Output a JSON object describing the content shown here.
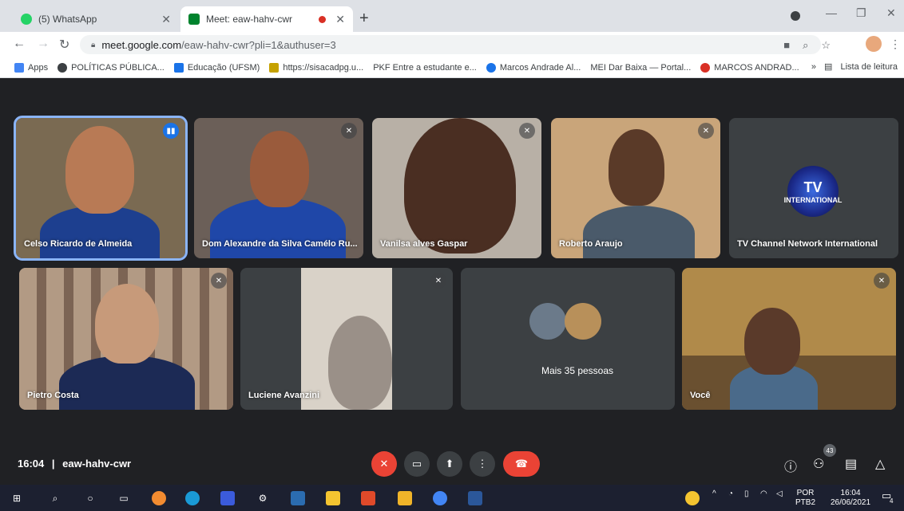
{
  "browser": {
    "tabs": [
      {
        "title": "(5) WhatsApp",
        "active": false,
        "favicon_color": "#25d366"
      },
      {
        "title": "Meet: eaw-hahv-cwr",
        "active": true,
        "favicon_color": "#00832d"
      }
    ],
    "new_tab_label": "+",
    "url_domain": "meet.google.com",
    "url_path": "/eaw-hahv-cwr?pli=1&authuser=3",
    "bookmarks": [
      {
        "label": "Apps",
        "color": "#4285f4"
      },
      {
        "label": "POLÍTICAS PÚBLICA...",
        "color": "#3c4043"
      },
      {
        "label": "Educação (UFSM)",
        "color": "#1a73e8"
      },
      {
        "label": "https://sisacadpg.u...",
        "color": "#c5a100"
      },
      {
        "label": "PKF Entre a estudante e...",
        "color": "#3c4043"
      },
      {
        "label": "Marcos Andrade Al...",
        "color": "#1a73e8"
      },
      {
        "label": "MEI Dar Baixa — Portal...",
        "color": "#0b3a7a"
      },
      {
        "label": "MARCOS ANDRAD...",
        "color": "#d93025"
      }
    ],
    "bookmarks_overflow": "»",
    "reading_list": "Lista de leitura"
  },
  "meet": {
    "participants": [
      {
        "name": "Celso Ricardo de Almeida",
        "state": "speaking"
      },
      {
        "name": "Dom Alexandre da Silva Camélo Ru...",
        "state": "muted"
      },
      {
        "name": "Vanilsa alves Gaspar",
        "state": "muted"
      },
      {
        "name": "Roberto Araujo",
        "state": "muted"
      },
      {
        "name": "TV Channel Network International",
        "state": "none"
      },
      {
        "name": "Pietro Costa",
        "state": "muted"
      },
      {
        "name": "Luciene Avanzini",
        "state": "muted"
      },
      {
        "name": "Você",
        "state": "muted"
      }
    ],
    "tv_logo_top": "TV",
    "tv_logo_text": "INTERNATIONAL",
    "others_label": "Mais 35 pessoas",
    "time": "16:04",
    "separator": "|",
    "meeting_code": "eaw-hahv-cwr",
    "participant_count": "43"
  },
  "taskbar": {
    "language": "POR",
    "layout": "PTB2",
    "time": "16:04",
    "date": "26/06/2021",
    "notifications": "4"
  }
}
